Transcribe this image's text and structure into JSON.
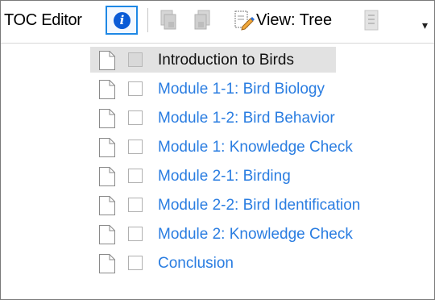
{
  "toolbar": {
    "title": "TOC Editor",
    "view_label": "View: Tree",
    "icons": [
      "info-icon",
      "page-add-icon",
      "page-add-disabled-icon",
      "edit-page-icon",
      "list-icon"
    ],
    "overflow_glyph": "▾"
  },
  "tree": {
    "items": [
      {
        "label": "Introduction to Birds",
        "selected": true
      },
      {
        "label": "Module 1-1: Bird Biology",
        "selected": false
      },
      {
        "label": "Module 1-2: Bird Behavior",
        "selected": false
      },
      {
        "label": "Module 1: Knowledge Check",
        "selected": false
      },
      {
        "label": "Module 2-1: Birding",
        "selected": false
      },
      {
        "label": "Module 2-2: Bird Identification",
        "selected": false
      },
      {
        "label": "Module 2: Knowledge Check",
        "selected": false
      },
      {
        "label": "Conclusion",
        "selected": false
      }
    ]
  },
  "colors": {
    "link": "#2a7de1",
    "selected_bg": "#e2e2e2",
    "info_blue": "#0a5bd6",
    "focus_border": "#1e88e5"
  }
}
